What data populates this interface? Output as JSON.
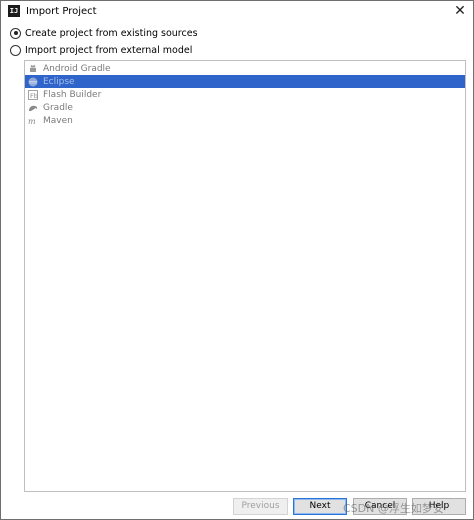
{
  "window": {
    "title": "Import Project",
    "app_icon_text": "IJ",
    "close_symbol": "✕"
  },
  "options": [
    {
      "label": "Create project from existing sources",
      "checked": true
    },
    {
      "label": "Import project from external model",
      "checked": false
    }
  ],
  "models": [
    {
      "label": "Android Gradle",
      "icon": "android-icon"
    },
    {
      "label": "Eclipse",
      "icon": "eclipse-icon",
      "selected": true
    },
    {
      "label": "Flash Builder",
      "icon": "flash-builder-icon"
    },
    {
      "label": "Gradle",
      "icon": "gradle-icon"
    },
    {
      "label": "Maven",
      "icon": "maven-icon"
    }
  ],
  "buttons": {
    "previous": "Previous",
    "next": "Next",
    "cancel": "Cancel",
    "help": "Help"
  },
  "watermark": "CSDN @浮生如梦安",
  "colors": {
    "selection": "#2f65ca",
    "default_button_border": "#2a74d6"
  }
}
